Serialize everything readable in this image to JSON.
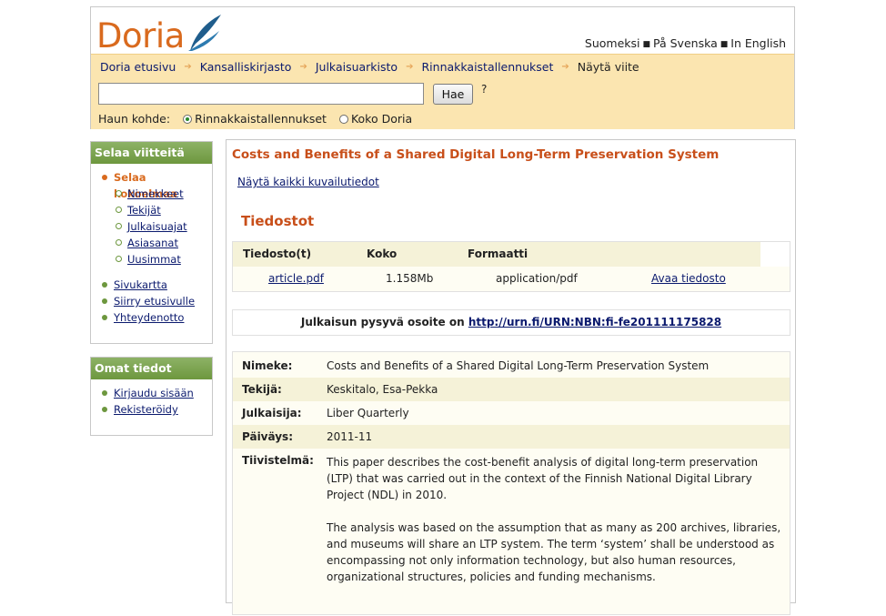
{
  "site": {
    "logo_text": "Doria",
    "languages": [
      "Suomeksi",
      "På Svenska",
      "In English"
    ]
  },
  "breadcrumb": {
    "items": [
      "Doria etusivu",
      "Kansalliskirjasto",
      "Julkaisuarkisto",
      "Rinnakkaistallennukset"
    ],
    "current": "Näytä viite"
  },
  "search": {
    "value": "",
    "button_label": "Hae",
    "help": "?",
    "scope_label": "Haun kohde:",
    "options": [
      {
        "label": "Rinnakkaistallennukset",
        "checked": true
      },
      {
        "label": "Koko Doria",
        "checked": false
      }
    ]
  },
  "sidebar": {
    "browse": {
      "heading": "Selaa viitteitä",
      "active_item": "Selaa kokoelmaa",
      "sub_items": [
        "Nimekkeet",
        "Tekijät",
        "Julkaisuajat",
        "Asiasanat",
        "Uusimmat"
      ],
      "links": [
        "Sivukartta",
        "Siirry etusivulle",
        "Yhteydenotto"
      ]
    },
    "account": {
      "heading": "Omat tiedot",
      "links": [
        "Kirjaudu sisään",
        "Rekisteröidy"
      ]
    }
  },
  "main": {
    "title": "Costs and Benefits of a Shared Digital Long-Term Preservation System",
    "show_all_link": "Näytä kaikki kuvailutiedot",
    "files_heading": "Tiedostot",
    "files_table": {
      "headers": [
        "Tiedosto(t)",
        "Koko",
        "Formaatti"
      ],
      "rows": [
        {
          "file": "article.pdf",
          "size": "1.158Mb",
          "format": "application/pdf",
          "action": "Avaa tiedosto"
        }
      ]
    },
    "urn": {
      "label": "Julkaisun pysyvä osoite on",
      "link": "http://urn.fi/URN:NBN:fi-fe201111175828"
    },
    "metadata": [
      {
        "label": "Nimeke:",
        "value": "Costs and Benefits of a Shared Digital Long-Term Preservation System"
      },
      {
        "label": "Tekijä:",
        "value": "Keskitalo, Esa-Pekka"
      },
      {
        "label": "Julkaisija:",
        "value": "Liber Quarterly"
      },
      {
        "label": "Päiväys:",
        "value": "2011-11"
      }
    ],
    "abstract": {
      "label": "Tiivistelmä:",
      "paragraphs": [
        "This paper describes the cost-benefit analysis of digital long-term preservation (LTP) that was carried out in the context of the Finnish National Digital Library Project (NDL) in 2010.",
        "The analysis was based on the assumption that as many as 200 archives, libraries, and museums will share an LTP system. The term ‘system’ shall be understood as encompassing not only information technology, but also human resources, organizational structures, policies and funding mechanisms."
      ]
    }
  },
  "colors": {
    "brand_orange": "#d96a1e",
    "header_band": "#fbe5b0",
    "sidebar_green": "#6d973e",
    "title_red": "#c84f1a",
    "link_blue": "#0b1a6e"
  }
}
